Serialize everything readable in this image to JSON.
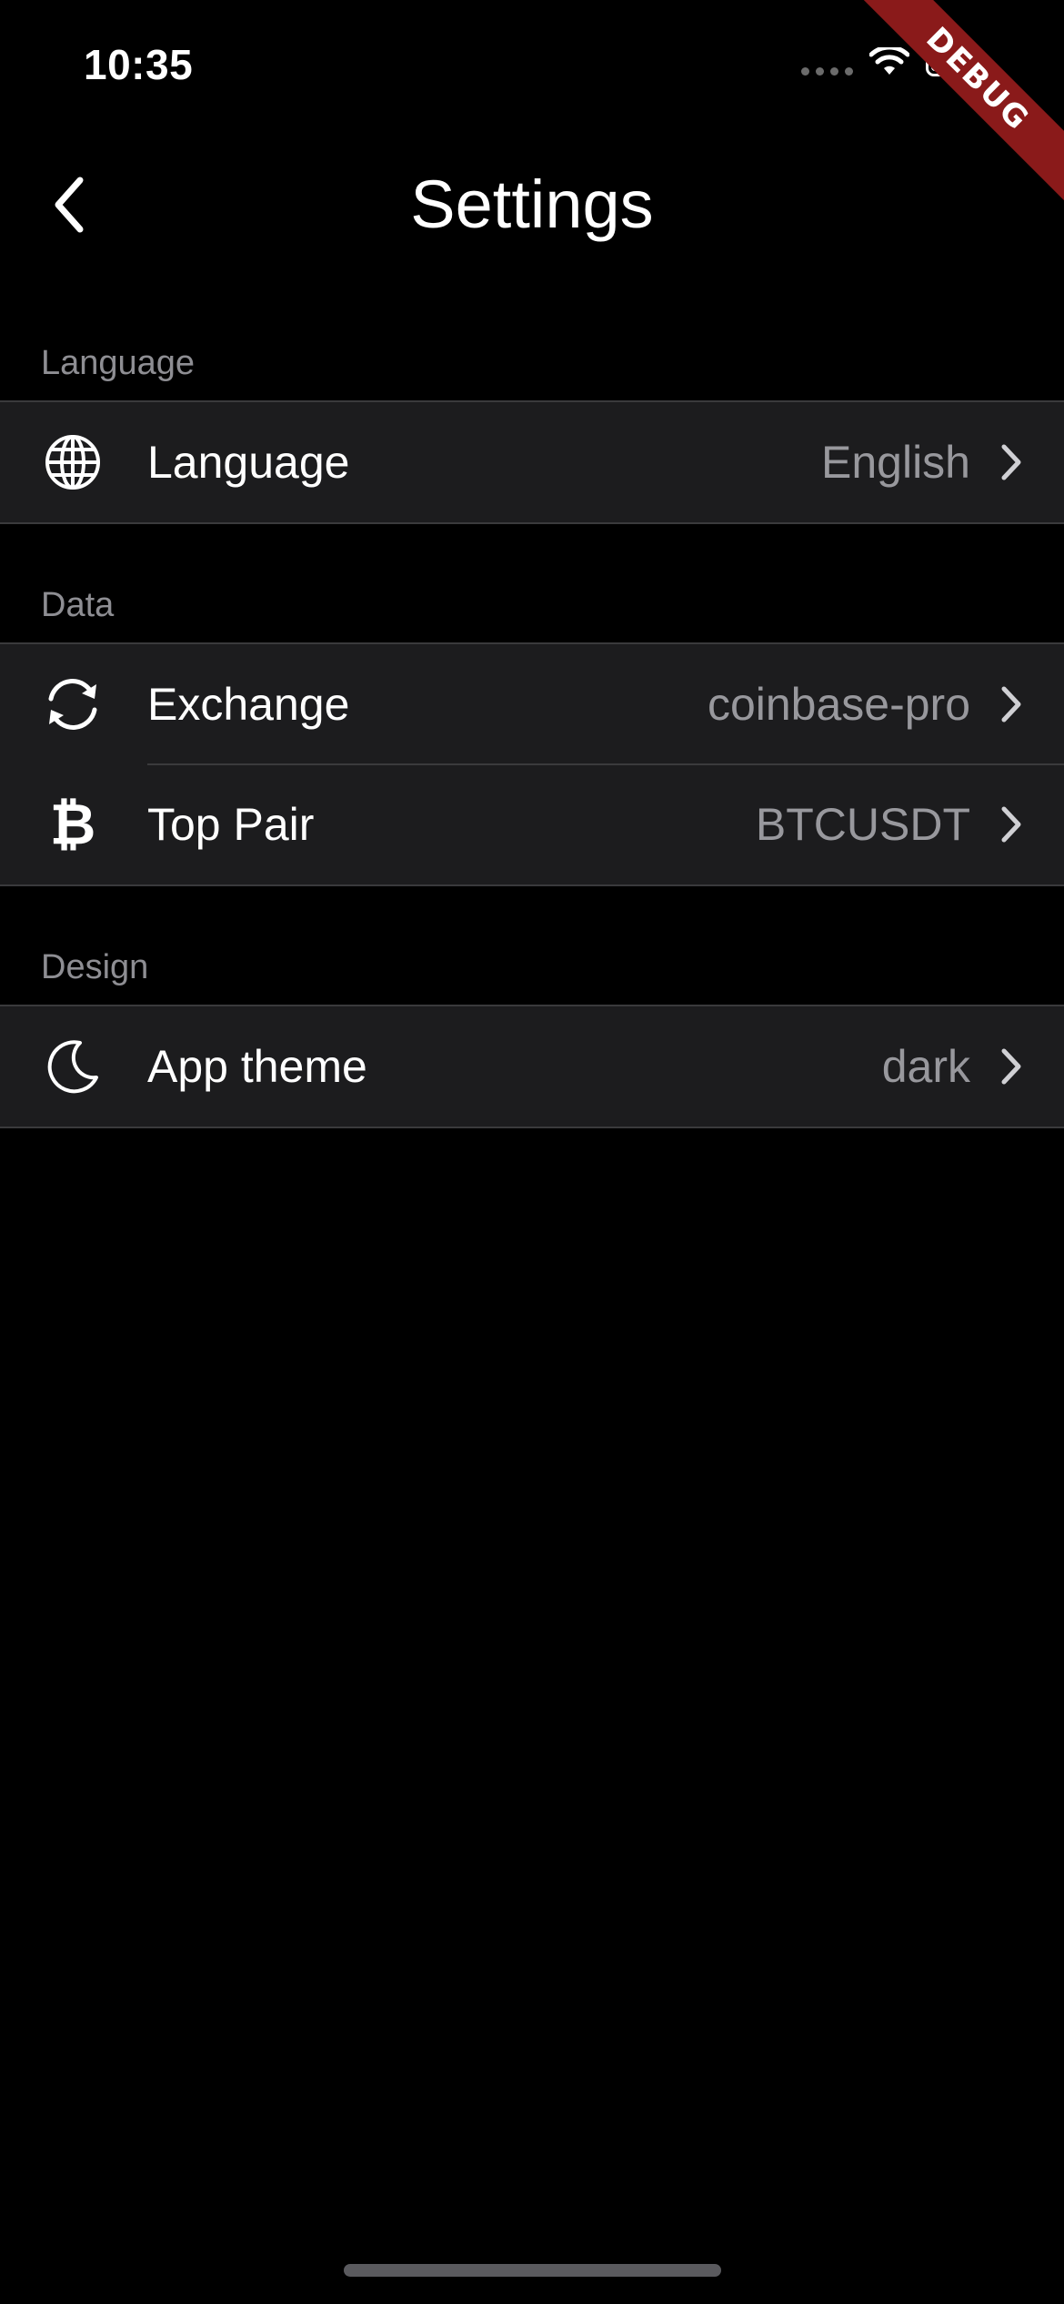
{
  "status_bar": {
    "time": "10:35",
    "icons": [
      "signal-dots",
      "wifi-icon",
      "battery-icon"
    ]
  },
  "debug_banner": {
    "label": "DEBUG",
    "color": "#8a1a1a"
  },
  "header": {
    "title": "Settings",
    "back_icon": "chevron-left-icon"
  },
  "sections": [
    {
      "title": "Language",
      "rows": [
        {
          "icon": "globe-icon",
          "label": "Language",
          "value": "English"
        }
      ]
    },
    {
      "title": "Data",
      "rows": [
        {
          "icon": "refresh-icon",
          "label": "Exchange",
          "value": "coinbase-pro"
        },
        {
          "icon": "bitcoin-icon",
          "label": "Top Pair",
          "value": "BTCUSDT"
        }
      ]
    },
    {
      "title": "Design",
      "rows": [
        {
          "icon": "moon-icon",
          "label": "App theme",
          "value": "dark"
        }
      ]
    }
  ],
  "colors": {
    "background": "#000000",
    "group_background": "#1c1c1e",
    "separator": "#3a3a3c",
    "secondary_text": "#98989d"
  }
}
